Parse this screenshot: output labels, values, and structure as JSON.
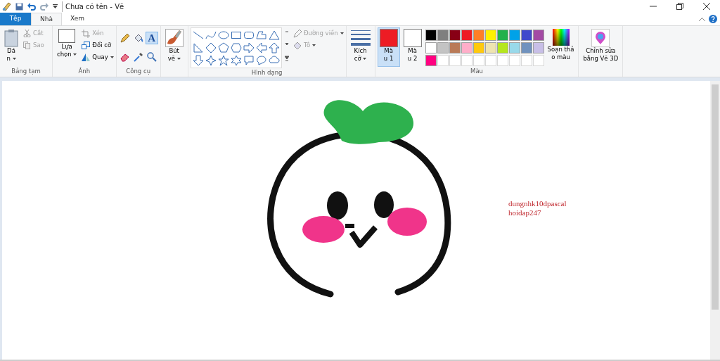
{
  "window": {
    "title": "Chưa có tên - Vẽ"
  },
  "tabs": [
    {
      "label": "Tệp",
      "kind": "file",
      "selected": false
    },
    {
      "label": "Nhà",
      "kind": "tab",
      "selected": true
    },
    {
      "label": "Xem",
      "kind": "tab",
      "selected": false
    }
  ],
  "clipboard": {
    "title": "Bảng tạm",
    "paste": [
      "Dá",
      "n"
    ],
    "tools": [
      {
        "label": "Cắt",
        "disabled": true
      },
      {
        "label": "Sao",
        "disabled": true
      }
    ]
  },
  "image": {
    "title": "Ảnh",
    "select": [
      "Lựa",
      "chọn"
    ],
    "tools": [
      {
        "label": "Xén",
        "disabled": true
      },
      {
        "label": "Đổi cỡ",
        "disabled": false
      },
      {
        "label": "Quay",
        "disabled": false
      }
    ]
  },
  "tools": {
    "title": "Công cụ",
    "items": [
      {
        "kind": "pencil",
        "selected": false
      },
      {
        "kind": "fill",
        "selected": false
      },
      {
        "kind": "text",
        "label": "A",
        "selected": true
      },
      {
        "kind": "eraser",
        "selected": false
      },
      {
        "kind": "picker",
        "selected": false
      },
      {
        "kind": "magnifier",
        "selected": false
      }
    ]
  },
  "brushes": {
    "label": [
      "Bút",
      "vẽ"
    ]
  },
  "shapes": {
    "title": "Hình dạng",
    "outline": {
      "label": "Đường viền",
      "disabled": true
    },
    "fill": {
      "label": "Tô",
      "disabled": true
    }
  },
  "size": {
    "label": [
      "Kích",
      "cỡ"
    ]
  },
  "colors": {
    "title": "Màu",
    "color1": {
      "label": [
        "Mà",
        "u 1"
      ],
      "color": "#ed1c24",
      "selected": true
    },
    "color2": {
      "label": [
        "Mà",
        "u 2"
      ],
      "color": "#ffffff",
      "selected": false
    },
    "palette": [
      [
        {
          "color": "#000000"
        },
        {
          "color": "#7f7f7f"
        },
        {
          "color": "#880015"
        },
        {
          "color": "#ed1c24"
        },
        {
          "color": "#ff7f27"
        },
        {
          "color": "#fff200"
        },
        {
          "color": "#22b14c"
        },
        {
          "color": "#00a2e8"
        },
        {
          "color": "#3f48cc"
        },
        {
          "color": "#a349a4"
        }
      ],
      [
        {
          "color": "#ffffff"
        },
        {
          "color": "#c3c3c3"
        },
        {
          "color": "#b97a57"
        },
        {
          "color": "#ffaec9"
        },
        {
          "color": "#ffc90e"
        },
        {
          "color": "#efe4b0"
        },
        {
          "color": "#b5e61d"
        },
        {
          "color": "#99d9ea"
        },
        {
          "color": "#7092be"
        },
        {
          "color": "#c8bfe7"
        }
      ]
    ],
    "custom": [
      {
        "color": "#ff0080"
      }
    ],
    "edit_colors": [
      "Soạn thả",
      "o màu"
    ]
  },
  "paint3d": {
    "label": [
      "Chỉnh sửa",
      "bằng Vẽ 3D"
    ]
  },
  "canvas": {
    "text_lines": [
      "dungnhk10dpascal",
      "hoidap247"
    ]
  }
}
